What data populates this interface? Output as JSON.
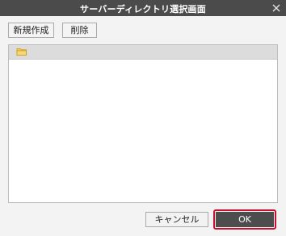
{
  "window": {
    "title": "サーバーディレクトリ選択画面",
    "close_icon": "close-icon"
  },
  "toolbar": {
    "new_label": "新規作成",
    "delete_label": "削除"
  },
  "tree": {
    "root_icon": "folder-icon",
    "root_icon_color": "#e8b62a"
  },
  "footer": {
    "cancel_label": "キャンセル",
    "ok_label": "OK",
    "ok_highlight_color": "#c8102e"
  }
}
